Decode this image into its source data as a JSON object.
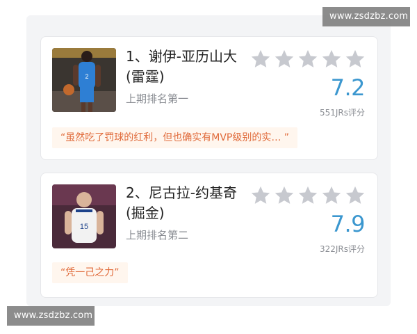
{
  "watermarks": {
    "top": "www.zsdzbz.com",
    "bottom": "www.zsdzbz.com"
  },
  "colors": {
    "accent_score": "#3b97cf",
    "quote_text": "#e06a3a",
    "star": "#c7c9cf"
  },
  "rankings": [
    {
      "title": "1、谢伊-亚历山大(雷霆)",
      "previous": "上期排名第一",
      "rating": "7.2",
      "votes": "551JRs评分",
      "quote": "“虽然吃了罚球的红利，但也确实有MVP级别的实…   ”",
      "player_number": "2"
    },
    {
      "title": "2、尼古拉-约基奇(掘金)",
      "previous": "上期排名第二",
      "rating": "7.9",
      "votes": "322JRs评分",
      "quote": "“凭一己之力”",
      "player_number": "15"
    }
  ]
}
